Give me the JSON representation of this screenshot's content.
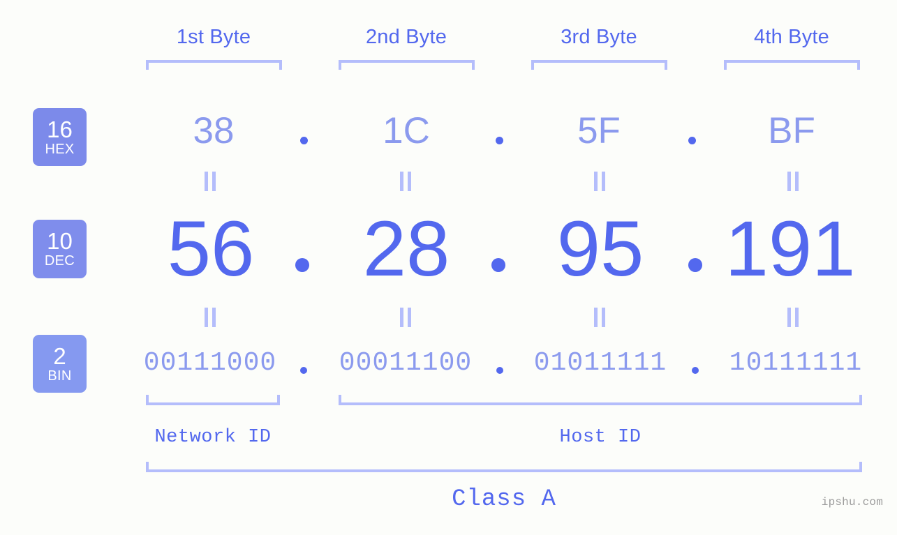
{
  "page": {
    "background_color": "#fcfdfa",
    "accent_color": "#5368ee",
    "accent_light_color": "#8b9aee",
    "bracket_color": "#b4bdfb",
    "badge_color": "#7c8aea",
    "watermark": "ipshu.com"
  },
  "byte_headers": [
    {
      "label": "1st Byte"
    },
    {
      "label": "2nd Byte"
    },
    {
      "label": "3rd Byte"
    },
    {
      "label": "4th Byte"
    }
  ],
  "bases": [
    {
      "number": "16",
      "name": "HEX"
    },
    {
      "number": "10",
      "name": "DEC"
    },
    {
      "number": "2",
      "name": "BIN"
    }
  ],
  "rows": {
    "hex": {
      "base": "16",
      "base_name": "HEX",
      "values": [
        "38",
        "1C",
        "5F",
        "BF"
      ],
      "separator": "."
    },
    "dec": {
      "base": "10",
      "base_name": "DEC",
      "values": [
        "56",
        "28",
        "95",
        "191"
      ],
      "separator": "."
    },
    "bin": {
      "base": "2",
      "base_name": "BIN",
      "values": [
        "00111000",
        "00011100",
        "01011111",
        "10111111"
      ],
      "separator": "."
    }
  },
  "equality_symbol": "=",
  "segments": {
    "network_id": {
      "label": "Network ID",
      "bytes": [
        1
      ]
    },
    "host_id": {
      "label": "Host ID",
      "bytes": [
        2,
        3,
        4
      ]
    }
  },
  "ip_class": {
    "label": "Class A"
  }
}
